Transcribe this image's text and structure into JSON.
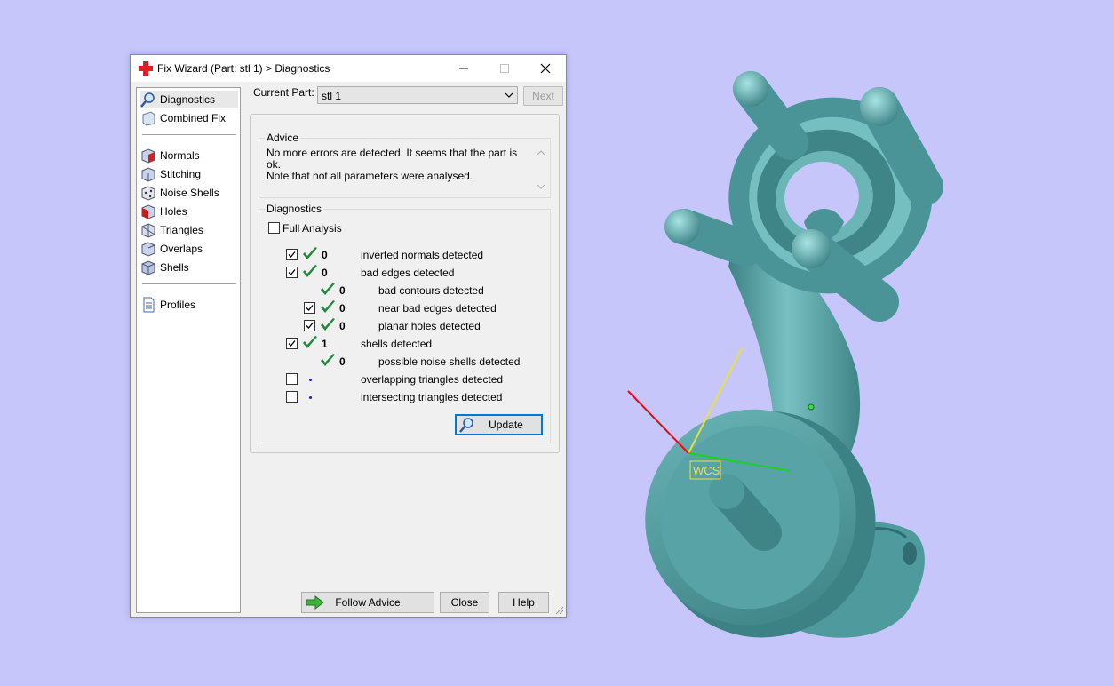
{
  "dialog": {
    "title": "Fix Wizard (Part: stl 1) > Diagnostics",
    "icon": "red-cross-icon"
  },
  "nav": {
    "items": [
      {
        "label": "Diagnostics",
        "icon": "magnifier-icon",
        "selected": true
      },
      {
        "label": "Combined Fix",
        "icon": "combined-fix-icon"
      },
      {
        "label": "Normals",
        "icon": "normals-icon"
      },
      {
        "label": "Stitching",
        "icon": "stitching-icon"
      },
      {
        "label": "Noise Shells",
        "icon": "noise-shells-icon"
      },
      {
        "label": "Holes",
        "icon": "holes-icon"
      },
      {
        "label": "Triangles",
        "icon": "triangles-icon"
      },
      {
        "label": "Overlaps",
        "icon": "overlaps-icon"
      },
      {
        "label": "Shells",
        "icon": "shells-icon"
      },
      {
        "label": "Profiles",
        "icon": "profiles-icon"
      }
    ]
  },
  "current_part": {
    "label": "Current Part:",
    "value": "stl 1",
    "next_label": "Next"
  },
  "advice": {
    "title": "Advice",
    "line1": "No more errors are detected. It seems that the part is ok.",
    "line2": "Note that not all parameters were analysed."
  },
  "diagnostics": {
    "title": "Diagnostics",
    "full_analysis_label": "Full Analysis",
    "rows": [
      {
        "checked": true,
        "status": "ok",
        "count": "0",
        "label": "inverted normals detected",
        "indent": 0
      },
      {
        "checked": true,
        "status": "ok",
        "count": "0",
        "label": "bad edges detected",
        "indent": 0
      },
      {
        "checked": null,
        "status": "ok",
        "count": "0",
        "label": "bad contours detected",
        "indent": 1
      },
      {
        "checked": true,
        "status": "ok",
        "count": "0",
        "label": "near bad edges detected",
        "indent": 1
      },
      {
        "checked": true,
        "status": "ok",
        "count": "0",
        "label": "planar holes detected",
        "indent": 1
      },
      {
        "checked": true,
        "status": "ok",
        "count": "1",
        "label": "shells detected",
        "indent": 0
      },
      {
        "checked": null,
        "status": "ok",
        "count": "0",
        "label": "possible noise shells detected",
        "indent": 1
      },
      {
        "checked": false,
        "status": "pending",
        "count": "",
        "label": "overlapping triangles detected",
        "indent": 0
      },
      {
        "checked": false,
        "status": "pending",
        "count": "",
        "label": "intersecting triangles detected",
        "indent": 0
      }
    ],
    "update_label": "Update"
  },
  "footer": {
    "follow_advice_label": "Follow Advice",
    "close_label": "Close",
    "help_label": "Help"
  },
  "viewport": {
    "wcs_label": "WCS",
    "background": "#c6c6fb",
    "model_color": "#5fa9ac"
  }
}
